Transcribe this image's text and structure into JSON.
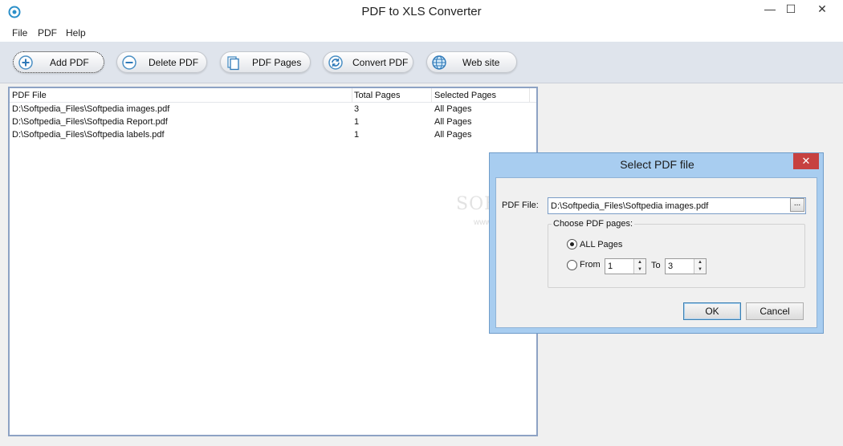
{
  "window": {
    "title": "PDF to XLS Converter",
    "min_label": "—",
    "max_label": "☐",
    "close_label": "✕"
  },
  "menu": {
    "items": [
      {
        "label": "File"
      },
      {
        "label": "PDF"
      },
      {
        "label": "Help"
      }
    ]
  },
  "toolbar": {
    "buttons": [
      {
        "label": "Add PDF",
        "icon": "add-icon"
      },
      {
        "label": "Delete PDF",
        "icon": "remove-icon"
      },
      {
        "label": "PDF Pages",
        "icon": "pages-icon"
      },
      {
        "label": "Convert PDF",
        "icon": "convert-icon"
      },
      {
        "label": "Web site",
        "icon": "globe-icon"
      }
    ]
  },
  "file_list": {
    "columns": [
      "PDF File",
      "Total Pages",
      "Selected Pages"
    ],
    "rows": [
      {
        "file": "D:\\Softpedia_Files\\Softpedia images.pdf",
        "total": "3",
        "selected": "All Pages"
      },
      {
        "file": "D:\\Softpedia_Files\\Softpedia Report.pdf",
        "total": "1",
        "selected": "All Pages"
      },
      {
        "file": "D:\\Softpedia_Files\\Softpedia labels.pdf",
        "total": "1",
        "selected": "All Pages"
      }
    ]
  },
  "watermark": {
    "text": "SOFTPEDIA",
    "sub": "www.softpedia.com"
  },
  "dialog": {
    "title": "Select PDF file",
    "close_label": "✕",
    "pdf_file_label": "PDF File:",
    "pdf_file_value": "D:\\Softpedia_Files\\Softpedia images.pdf",
    "browse_label": "...",
    "group_title": "Choose PDF pages:",
    "all_pages_label": "ALL Pages",
    "from_label": "From",
    "from_value": "1",
    "to_label": "To",
    "to_value": "3",
    "ok_label": "OK",
    "cancel_label": "Cancel",
    "selected_option": "ALL Pages"
  },
  "colors": {
    "toolbar_bg": "#dfe4ec",
    "list_border": "#8da2c4",
    "dialog_frame": "#a8cdf0",
    "dialog_close": "#c74140"
  }
}
